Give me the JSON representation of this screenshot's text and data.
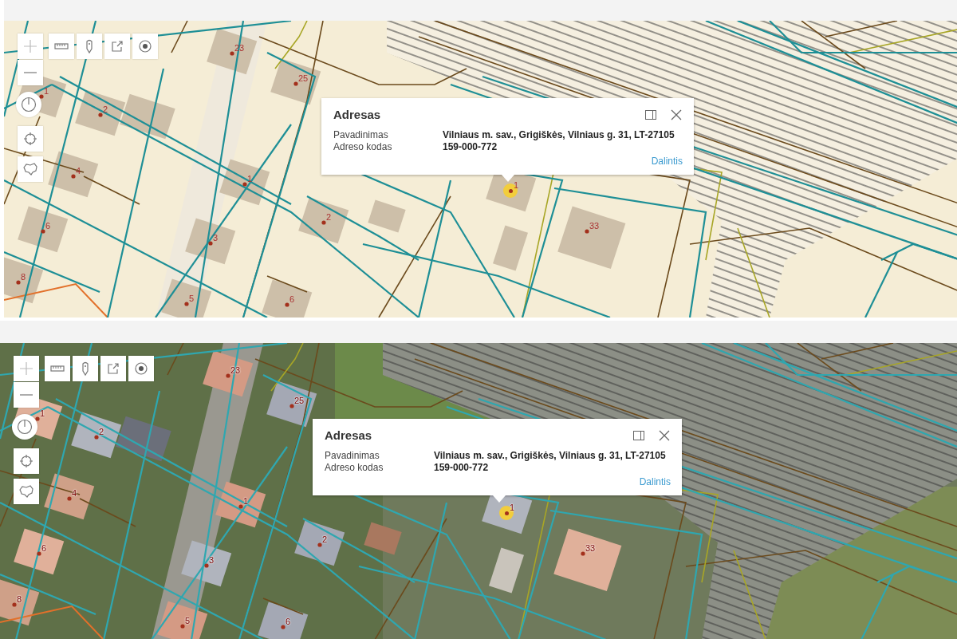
{
  "panels": [
    {
      "kind": "topographic",
      "labels": [
        "23",
        "25",
        "1",
        "2",
        "4",
        "1",
        "2",
        "6",
        "3",
        "8",
        "5",
        "6",
        "33",
        "1"
      ],
      "popup": {
        "title": "Adresas",
        "fields": [
          {
            "label": "Pavadinimas",
            "value": "Vilniaus m. sav., Grigiškės, Vilniaus g. 31, LT-27105"
          },
          {
            "label": "Adreso kodas",
            "value": "159-000-772"
          }
        ],
        "link": "Dalintis"
      }
    },
    {
      "kind": "orthophoto",
      "labels": [
        "23",
        "25",
        "1",
        "2",
        "4",
        "1",
        "2",
        "6",
        "3",
        "8",
        "5",
        "6",
        "33",
        "1"
      ],
      "popup": {
        "title": "Adresas",
        "fields": [
          {
            "label": "Pavadinimas",
            "value": "Vilniaus m. sav., Grigiškės, Vilniaus g. 31, LT-27105"
          },
          {
            "label": "Adreso kodas",
            "value": "159-000-772"
          }
        ],
        "link": "Dalintis"
      }
    }
  ]
}
